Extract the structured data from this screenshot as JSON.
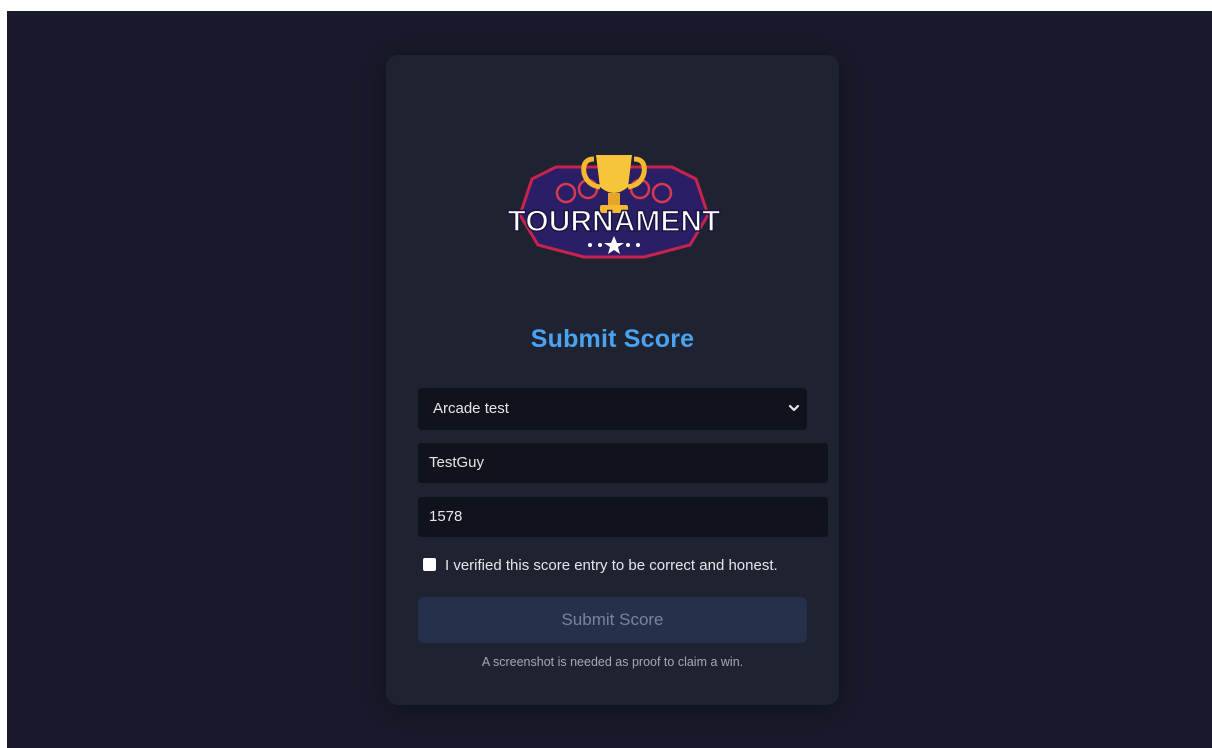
{
  "logo": {
    "text": "TOURNAMENT"
  },
  "form": {
    "title": "Submit Score",
    "game_select": {
      "selected": "Arcade test"
    },
    "player_field": {
      "value": "TestGuy"
    },
    "score_field": {
      "value": "1578"
    },
    "verify_checkbox": {
      "checked": false,
      "label": "I verified this score entry to be correct and honest."
    },
    "submit_label": "Submit Score",
    "note": "A screenshot is needed as proof to claim a win."
  },
  "colors": {
    "page_background": "#181a2b",
    "card_background": "#1f2230",
    "title_accent": "#4aa3f0",
    "input_background": "#11131c",
    "submit_disabled": "#25304a"
  },
  "icons": {
    "logo": "trophy-icon",
    "select_chevron": "chevron-down-icon"
  }
}
